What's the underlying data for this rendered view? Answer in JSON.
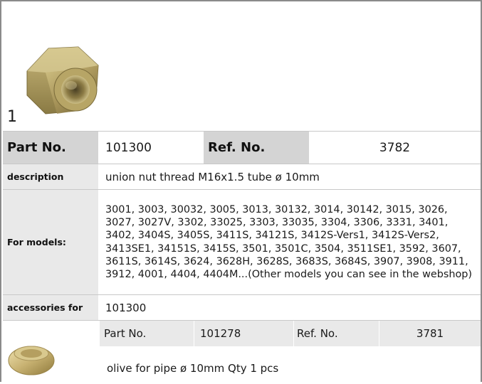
{
  "product": {
    "figure_number": "1",
    "image_icon": "union-nut-image",
    "part_no_label": "Part No.",
    "part_no": "101300",
    "ref_no_label": "Ref. No.",
    "ref_no": "3782"
  },
  "description": {
    "label": "description",
    "value": "union nut  thread M16x1.5 tube ø 10mm"
  },
  "models": {
    "label": "For models:",
    "value": "3001, 3003, 30032, 3005, 3013, 30132, 3014, 30142, 3015, 3026, 3027, 3027V, 3302, 33025, 3303, 33035, 3304, 3306, 3331, 3401, 3402, 3404S, 3405S, 3411S, 34121S, 3412S-Vers1, 3412S-Vers2, 3413SE1, 34151S, 3415S, 3501, 3501C, 3504, 3511SE1, 3592, 3607, 3611S, 3614S, 3624, 3628H, 3628S, 3683S, 3684S, 3907, 3908, 3911, 3912, 4001, 4404, 4404M...(Other models you can see in the webshop)"
  },
  "accessories": {
    "label": "accessories for",
    "value": "101300",
    "items": [
      {
        "image_icon": "olive-ring-image",
        "part_no_label": "Part No.",
        "part_no": "101278",
        "ref_no_label": "Ref. No.",
        "ref_no": "3781",
        "description": "olive  for pipe ø 10mm Qty 1 pcs"
      }
    ]
  }
}
